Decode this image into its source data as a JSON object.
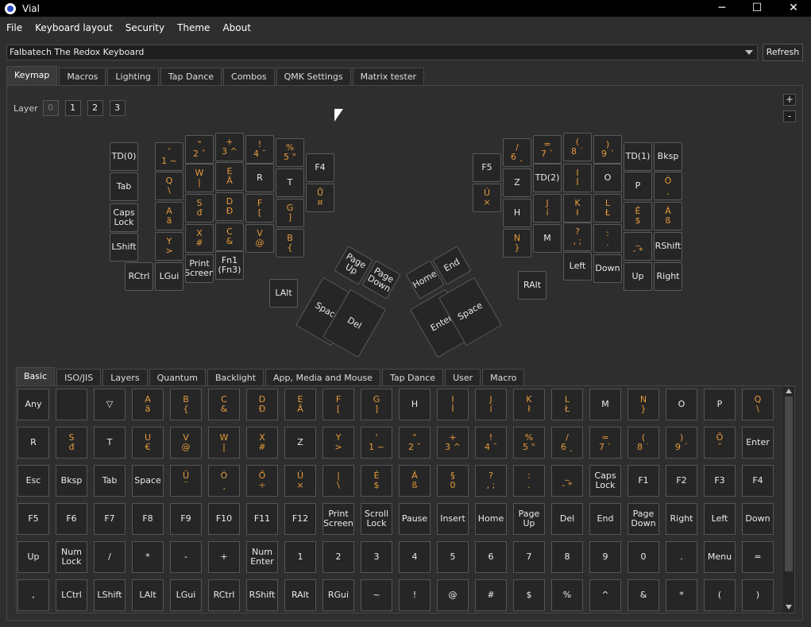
{
  "window": {
    "title": "Vial",
    "minimize": "─",
    "maximize": "☐",
    "close": "✕"
  },
  "menu": [
    "File",
    "Keyboard layout",
    "Security",
    "Theme",
    "About"
  ],
  "keyboard_select": {
    "value": "Falbatech The Redox Keyboard",
    "refresh": "Refresh"
  },
  "tabs": [
    "Keymap",
    "Macros",
    "Lighting",
    "Tap Dance",
    "Combos",
    "QMK Settings",
    "Matrix tester"
  ],
  "active_tab": "Keymap",
  "layer": {
    "label": "Layer",
    "buttons": [
      "0",
      "1",
      "2",
      "3"
    ],
    "active": "0",
    "plus": "+",
    "minus": "-"
  },
  "keymap": {
    "left": [
      [
        "TD(0)"
      ],
      [
        "'",
        "1 ~"
      ],
      [
        "\"",
        "2 ˇ"
      ],
      [
        "+",
        "3 ^"
      ],
      [
        "!",
        "4 ˘"
      ],
      [
        "%",
        "5 °"
      ],
      [
        "F4"
      ],
      [
        "Tab"
      ],
      [
        "Q",
        "\\"
      ],
      [
        "W",
        "|"
      ],
      [
        "E",
        "Ä"
      ],
      [
        "R"
      ],
      [
        "T"
      ],
      [
        "Ů",
        "¤"
      ],
      [
        "Caps Lock"
      ],
      [
        "A",
        "ä"
      ],
      [
        "S",
        "đ"
      ],
      [
        "D",
        "Đ"
      ],
      [
        "F",
        "["
      ],
      [
        "G",
        "]"
      ],
      [
        "LShift"
      ],
      [
        "Y",
        ">"
      ],
      [
        "X",
        "#"
      ],
      [
        "C",
        "&"
      ],
      [
        "V",
        "@"
      ],
      [
        "B",
        "{"
      ],
      [
        "RCtrl"
      ],
      [
        "LGui"
      ],
      [
        "Print Screen"
      ],
      [
        "Fn1 (Fn3)"
      ],
      [
        "LAlt"
      ],
      [
        "Page Up"
      ],
      [
        "Page Down"
      ],
      [
        "Space"
      ],
      [
        "Del"
      ]
    ],
    "right": [
      [
        "F5"
      ],
      [
        "/",
        "6 ˛"
      ],
      [
        "=",
        "7 `"
      ],
      [
        "(",
        "8 ˙"
      ],
      [
        ")",
        "9 ´"
      ],
      [
        "TD(1)"
      ],
      [
        "Bksp"
      ],
      [
        "Z"
      ],
      [
        "TD(2)"
      ],
      [
        "I",
        "Í"
      ],
      [
        "O"
      ],
      [
        "P"
      ],
      [
        "Ó",
        "˛"
      ],
      [
        "Ú",
        "×"
      ],
      [
        "H"
      ],
      [
        "J",
        "í"
      ],
      [
        "K",
        "ł"
      ],
      [
        "L",
        "Ł"
      ],
      [
        "É",
        "$"
      ],
      [
        "Á",
        "ß"
      ],
      [
        "N",
        "}"
      ],
      [
        "M"
      ],
      [
        "?",
        ", ;"
      ],
      [
        ":",
        ". "
      ],
      [
        "_",
        "- *"
      ],
      [
        "RShift"
      ],
      [
        "Left"
      ],
      [
        "Down"
      ],
      [
        "Up"
      ],
      [
        "Right"
      ],
      [
        "RAlt"
      ],
      [
        "Home"
      ],
      [
        "End"
      ],
      [
        "Enter"
      ],
      [
        "Space"
      ]
    ]
  },
  "palette_tabs": [
    "Basic",
    "ISO/JIS",
    "Layers",
    "Quantum",
    "Backlight",
    "App, Media and Mouse",
    "Tap Dance",
    "User",
    "Macro"
  ],
  "palette_active": "Basic",
  "palette": [
    [
      [
        "Any"
      ],
      [
        ""
      ],
      [
        "▽"
      ],
      [
        "A",
        "ä"
      ],
      [
        "B",
        "{"
      ],
      [
        "C",
        "&"
      ],
      [
        "D",
        "Đ"
      ],
      [
        "E",
        "Ä"
      ],
      [
        "F",
        "["
      ],
      [
        "G",
        "]"
      ],
      [
        "H"
      ],
      [
        "I",
        "Í"
      ],
      [
        "J",
        "í"
      ],
      [
        "K",
        "ł"
      ],
      [
        "L",
        "Ł"
      ],
      [
        "M"
      ],
      [
        "N",
        "}"
      ],
      [
        "O"
      ],
      [
        "P"
      ],
      [
        "Q",
        "\\"
      ]
    ],
    [
      [
        "R"
      ],
      [
        "S",
        "đ"
      ],
      [
        "T"
      ],
      [
        "U",
        "€"
      ],
      [
        "V",
        "@"
      ],
      [
        "W",
        "|"
      ],
      [
        "X",
        "#"
      ],
      [
        "Z"
      ],
      [
        "Y",
        ">"
      ],
      [
        "'",
        "1 ~"
      ],
      [
        "\"",
        "2 ˇ"
      ],
      [
        "+",
        "3 ^"
      ],
      [
        "!",
        "4 ˘"
      ],
      [
        "%",
        "5 °"
      ],
      [
        "/",
        "6 ˛"
      ],
      [
        "=",
        "7 `"
      ],
      [
        "(",
        "8 ˙"
      ],
      [
        ")",
        "9 ´"
      ],
      [
        "Ö",
        "˝"
      ],
      [
        "Enter"
      ]
    ],
    [
      [
        "Esc"
      ],
      [
        "Bksp"
      ],
      [
        "Tab"
      ],
      [
        "Space"
      ],
      [
        "Ü",
        "¨"
      ],
      [
        "Ó",
        "¸"
      ],
      [
        "Ő",
        "÷"
      ],
      [
        "Ú",
        "×"
      ],
      [
        "|",
        "\\"
      ],
      [
        "É",
        "$"
      ],
      [
        "Á",
        "ß"
      ],
      [
        "§",
        "0"
      ],
      [
        "?",
        ", ;"
      ],
      [
        ":",
        ". "
      ],
      [
        "_",
        "- *"
      ],
      [
        "Caps Lock"
      ],
      [
        "F1"
      ],
      [
        "F2"
      ],
      [
        "F3"
      ],
      [
        "F4"
      ]
    ],
    [
      [
        "F5"
      ],
      [
        "F6"
      ],
      [
        "F7"
      ],
      [
        "F8"
      ],
      [
        "F9"
      ],
      [
        "F10"
      ],
      [
        "F11"
      ],
      [
        "F12"
      ],
      [
        "Print Screen"
      ],
      [
        "Scroll Lock"
      ],
      [
        "Pause"
      ],
      [
        "Insert"
      ],
      [
        "Home"
      ],
      [
        "Page Up"
      ],
      [
        "Del"
      ],
      [
        "End"
      ],
      [
        "Page Down"
      ],
      [
        "Right"
      ],
      [
        "Left"
      ],
      [
        "Down"
      ]
    ],
    [
      [
        "Up"
      ],
      [
        "Num Lock"
      ],
      [
        "/"
      ],
      [
        "*"
      ],
      [
        "-"
      ],
      [
        "+"
      ],
      [
        "Num Enter"
      ],
      [
        "1"
      ],
      [
        "2"
      ],
      [
        "3"
      ],
      [
        "4"
      ],
      [
        "5"
      ],
      [
        "6"
      ],
      [
        "7"
      ],
      [
        "8"
      ],
      [
        "9"
      ],
      [
        "0"
      ],
      [
        "."
      ],
      [
        "Menu"
      ],
      [
        "="
      ]
    ],
    [
      [
        ","
      ],
      [
        "LCtrl"
      ],
      [
        "LShift"
      ],
      [
        "LAlt"
      ],
      [
        "LGui"
      ],
      [
        "RCtrl"
      ],
      [
        "RShift"
      ],
      [
        "RAlt"
      ],
      [
        "RGui"
      ],
      [
        "~"
      ],
      [
        "!"
      ],
      [
        "@"
      ],
      [
        "#"
      ],
      [
        "$"
      ],
      [
        "%"
      ],
      [
        "^"
      ],
      [
        "&"
      ],
      [
        "*"
      ],
      [
        "("
      ],
      [
        ")"
      ]
    ]
  ]
}
